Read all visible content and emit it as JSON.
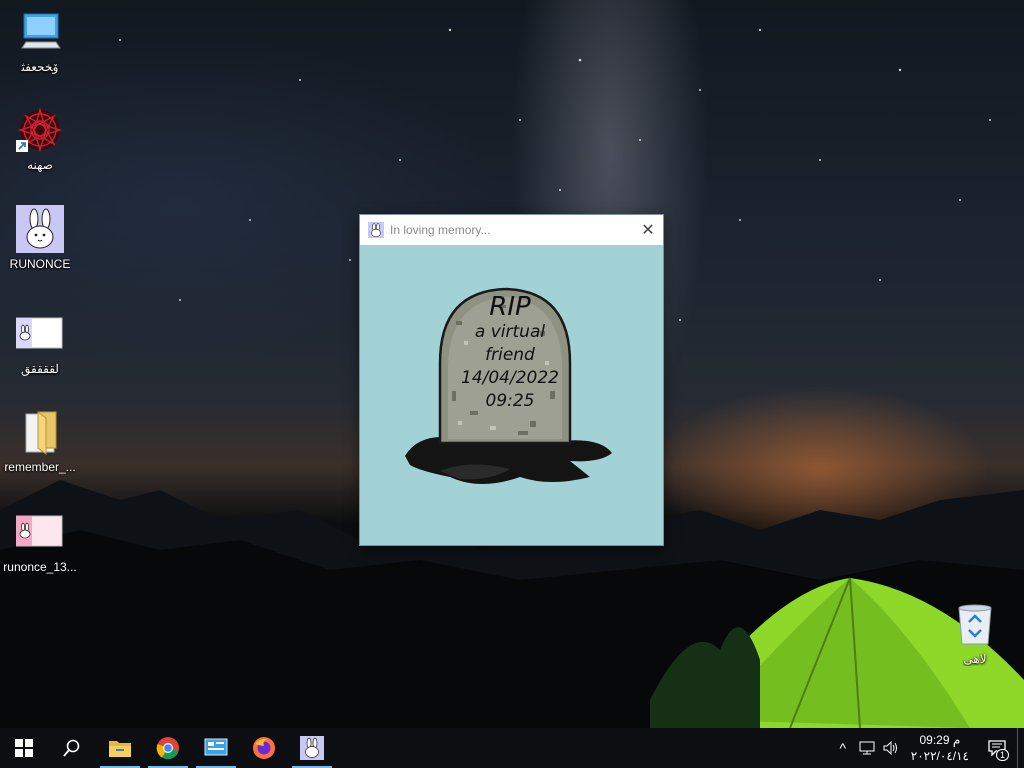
{
  "desktop": {
    "icons": [
      {
        "label": "ﯙﺨﺤﻌﻔﺜ",
        "icon": "computer-icon"
      },
      {
        "label": "ﺻﻬﻨﻪ",
        "icon": "mandala-shortcut-icon"
      },
      {
        "label": "RUNONCE",
        "icon": "bunny-app-icon"
      },
      {
        "label": "ﻟﻘﻘﻘﻘﻖ",
        "icon": "bunny-image-icon"
      },
      {
        "label": "remember_...",
        "icon": "folder-icon"
      },
      {
        "label": "runonce_13...",
        "icon": "bunny-pink-image-icon"
      }
    ],
    "recycle_bin": {
      "label": "ﻻﻫﻰ",
      "icon": "recycle-bin-icon"
    }
  },
  "window": {
    "title": "In loving memory...",
    "close_symbol": "✕",
    "tombstone": {
      "rip": "RIP",
      "line1": "a virtual",
      "line2": "friend",
      "date": "14/04/2022",
      "time": "09:25"
    }
  },
  "taskbar": {
    "buttons": [
      {
        "icon": "windows-start-icon"
      },
      {
        "icon": "search-icon"
      },
      {
        "icon": "file-explorer-icon"
      },
      {
        "icon": "chrome-icon"
      },
      {
        "icon": "control-panel-icon"
      },
      {
        "icon": "firefox-icon"
      },
      {
        "icon": "bunny-app-icon",
        "active": true
      }
    ],
    "tray": {
      "chevron": "^",
      "time": "09:29 م",
      "date": "٢٠٢٢/٠٤/١٤",
      "notification_count": "1"
    }
  },
  "colors": {
    "window_bg": "#a2d2d5",
    "taskbar": "#0d0e12",
    "active_underline": "#76b9ed"
  }
}
